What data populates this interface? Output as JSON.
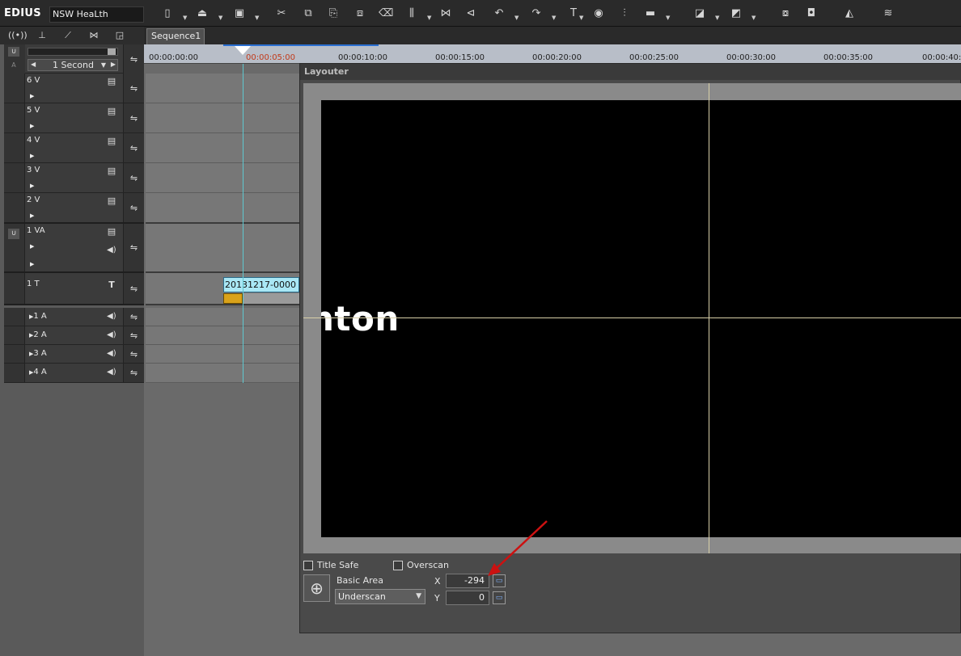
{
  "app": {
    "name": "EDIUS",
    "project": "NSW HeaLth"
  },
  "toolbar": {
    "icons": [
      "new-project-icon",
      "open-project-icon",
      "save-icon",
      "cut-icon",
      "copy-icon",
      "paste-icon",
      "replace-icon",
      "delete-icon",
      "split-icon",
      "ripple-icon",
      "undo-icon",
      "redo-icon",
      "text-icon",
      "color-icon",
      "mixer-icon",
      "link-icon",
      "export-icon",
      "marker-icon",
      "capture-icon",
      "screenshot-icon",
      "render-icon",
      "waveform-icon"
    ]
  },
  "left_panel": {
    "zoom": {
      "label": "1 Second"
    },
    "tracks": [
      {
        "name": "6 V",
        "kind": "video"
      },
      {
        "name": "5 V",
        "kind": "video"
      },
      {
        "name": "4 V",
        "kind": "video"
      },
      {
        "name": "3 V",
        "kind": "video"
      },
      {
        "name": "2 V",
        "kind": "video"
      },
      {
        "name": "1 VA",
        "kind": "video-audio"
      },
      {
        "name": "1 T",
        "kind": "title"
      },
      {
        "name": "1 A",
        "kind": "audio"
      },
      {
        "name": "2 A",
        "kind": "audio"
      },
      {
        "name": "3 A",
        "kind": "audio"
      },
      {
        "name": "4 A",
        "kind": "audio"
      }
    ]
  },
  "timeline": {
    "tab": "Sequence1",
    "timecodes": [
      "00:00:00:00",
      "00:00:05:00",
      "00:00:10:00",
      "00:00:15:00",
      "00:00:20:00",
      "00:00:25:00",
      "00:00:30:00",
      "00:00:35:00",
      "00:00:40:"
    ],
    "clip": {
      "label": "20131217-0000"
    }
  },
  "layouter": {
    "title": "Layouter",
    "preview_text": "nton",
    "title_safe_label": "Title Safe",
    "overscan_label": "Overscan",
    "area_label": "Basic Area",
    "scan_value": "Underscan",
    "x_label": "X",
    "x_value": "-294",
    "y_label": "Y",
    "y_value": "0"
  },
  "colors": {
    "annotation_arrow": "#cc1111",
    "playhead": "#5ec8d0",
    "clip": "#a9e7f5",
    "ruler": "#b8bec8"
  }
}
